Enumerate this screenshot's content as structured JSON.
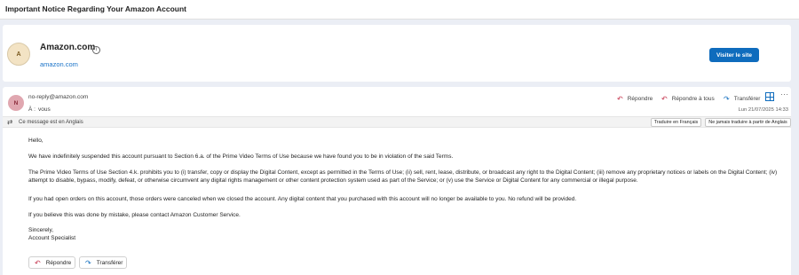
{
  "subject": "Important Notice Regarding Your Amazon Account",
  "sender_card": {
    "logo_letter": "A",
    "name": "Amazon.com",
    "info_icon": "info-icon",
    "domain": "amazon.com",
    "visit_label": "Visiter le site"
  },
  "message": {
    "avatar_letter": "N",
    "from": "no-reply@amazon.com",
    "to_label": "À :",
    "to_value": "vous",
    "date": "Lun 21/07/2025 14:33",
    "actions": {
      "reply": "Répondre",
      "reply_all": "Répondre à tous",
      "forward": "Transférer"
    },
    "language_bar": {
      "text": "Ce message est en Anglais",
      "translate_label": "Traduire en Français",
      "never_label": "Ne jamais traduire à partir de Anglais"
    },
    "body": [
      "Hello,",
      "We have indefinitely suspended this account pursuant to Section 6.a. of the Prime Video Terms of Use because we have found you to be in violation of the said Terms.",
      "The Prime Video Terms of Use Section 4.k. prohibits you to (i) transfer, copy or display the Digital Content, except as permitted in the Terms of Use; (ii) sell, rent, lease, distribute, or broadcast any right to the Digital Content; (iii) remove any proprietary notices or labels on the Digital Content; (iv) attempt to disable, bypass, modify, defeat, or otherwise circumvent any digital rights management or other content protection system used as part of the Service; or (v) use the Service or Digital Content for any commercial or illegal purpose.",
      "If you had open orders on this account, those orders were canceled when we closed the account. Any digital content that you purchased with this account will no longer be available to you. No refund will be provided.",
      "If you believe this was done by mistake, please contact Amazon Customer Service.",
      "Sincerely,",
      "Account Specialist"
    ],
    "bottom_buttons": {
      "reply": "Répondre",
      "forward": "Transférer"
    }
  },
  "colors": {
    "accent": "#0f6cbd",
    "reply_icon": "#c4314b",
    "background": "#ebeef5"
  }
}
